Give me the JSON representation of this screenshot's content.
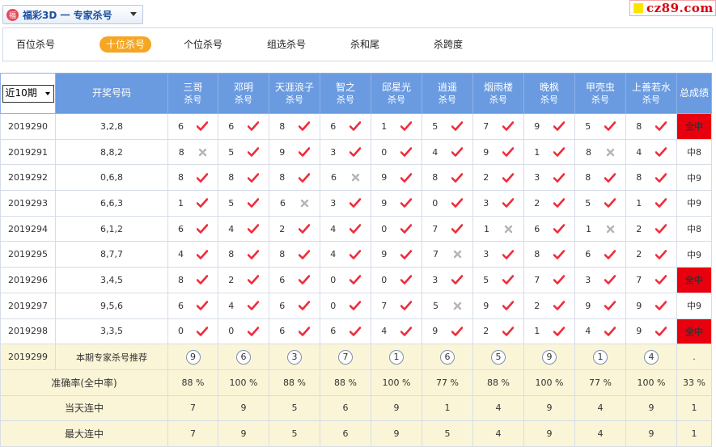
{
  "header": {
    "lottery_title": "福彩3D 一 专家杀号",
    "site": "cz89.com"
  },
  "tabs": [
    {
      "label": "百位杀号",
      "active": false
    },
    {
      "label": "十位杀号",
      "active": true
    },
    {
      "label": "个位杀号",
      "active": false
    },
    {
      "label": "组选杀号",
      "active": false
    },
    {
      "label": "杀和尾",
      "active": false
    },
    {
      "label": "杀跨度",
      "active": false
    }
  ],
  "table": {
    "period_select": "近10期",
    "draw_col_label": "开奖号码",
    "total_col_label": "总成绩",
    "experts": [
      {
        "name": "三哥",
        "sub": "杀号"
      },
      {
        "name": "邓明",
        "sub": "杀号"
      },
      {
        "name": "天涯浪子",
        "sub": "杀号"
      },
      {
        "name": "智之",
        "sub": "杀号"
      },
      {
        "name": "邱星光",
        "sub": "杀号"
      },
      {
        "name": "逍遥",
        "sub": "杀号"
      },
      {
        "name": "烟雨楼",
        "sub": "杀号"
      },
      {
        "name": "晚枫",
        "sub": "杀号"
      },
      {
        "name": "甲壳虫",
        "sub": "杀号"
      },
      {
        "name": "上善若水",
        "sub": "杀号"
      }
    ],
    "rows": [
      {
        "period": "2019290",
        "draw": "3,2,8",
        "picks": [
          "6",
          "6",
          "8",
          "6",
          "1",
          "5",
          "7",
          "9",
          "5",
          "8"
        ],
        "hits": [
          1,
          1,
          1,
          1,
          1,
          1,
          1,
          1,
          1,
          1
        ],
        "result": "全中",
        "full": true
      },
      {
        "period": "2019291",
        "draw": "8,8,2",
        "picks": [
          "8",
          "5",
          "9",
          "3",
          "0",
          "4",
          "9",
          "1",
          "8",
          "4"
        ],
        "hits": [
          0,
          1,
          1,
          1,
          1,
          1,
          1,
          1,
          0,
          1
        ],
        "result": "中8",
        "full": false
      },
      {
        "period": "2019292",
        "draw": "0,6,8",
        "picks": [
          "8",
          "8",
          "8",
          "6",
          "9",
          "8",
          "2",
          "3",
          "8",
          "8"
        ],
        "hits": [
          1,
          1,
          1,
          0,
          1,
          1,
          1,
          1,
          1,
          1
        ],
        "result": "中9",
        "full": false
      },
      {
        "period": "2019293",
        "draw": "6,6,3",
        "picks": [
          "1",
          "5",
          "6",
          "3",
          "9",
          "0",
          "3",
          "2",
          "5",
          "1"
        ],
        "hits": [
          1,
          1,
          0,
          1,
          1,
          1,
          1,
          1,
          1,
          1
        ],
        "result": "中9",
        "full": false
      },
      {
        "period": "2019294",
        "draw": "6,1,2",
        "picks": [
          "6",
          "4",
          "2",
          "4",
          "0",
          "7",
          "1",
          "6",
          "1",
          "2"
        ],
        "hits": [
          1,
          1,
          1,
          1,
          1,
          1,
          0,
          1,
          0,
          1
        ],
        "result": "中8",
        "full": false
      },
      {
        "period": "2019295",
        "draw": "8,7,7",
        "picks": [
          "4",
          "8",
          "8",
          "4",
          "9",
          "7",
          "3",
          "8",
          "6",
          "2"
        ],
        "hits": [
          1,
          1,
          1,
          1,
          1,
          0,
          1,
          1,
          1,
          1
        ],
        "result": "中9",
        "full": false
      },
      {
        "period": "2019296",
        "draw": "3,4,5",
        "picks": [
          "8",
          "2",
          "6",
          "0",
          "0",
          "3",
          "5",
          "7",
          "3",
          "7"
        ],
        "hits": [
          1,
          1,
          1,
          1,
          1,
          1,
          1,
          1,
          1,
          1
        ],
        "result": "全中",
        "full": true
      },
      {
        "period": "2019297",
        "draw": "9,5,6",
        "picks": [
          "6",
          "4",
          "6",
          "0",
          "7",
          "5",
          "9",
          "2",
          "9",
          "9"
        ],
        "hits": [
          1,
          1,
          1,
          1,
          1,
          0,
          1,
          1,
          1,
          1
        ],
        "result": "中9",
        "full": false
      },
      {
        "period": "2019298",
        "draw": "3,3,5",
        "picks": [
          "0",
          "0",
          "6",
          "6",
          "4",
          "9",
          "2",
          "1",
          "4",
          "9"
        ],
        "hits": [
          1,
          1,
          1,
          1,
          1,
          1,
          1,
          1,
          1,
          1
        ],
        "result": "全中",
        "full": true
      }
    ],
    "recommend": {
      "period": "2019299",
      "label": "本期专家杀号推荐",
      "picks": [
        "9",
        "6",
        "3",
        "7",
        "1",
        "6",
        "5",
        "9",
        "1",
        "4"
      ],
      "total": "."
    },
    "stats": [
      {
        "label": "准确率(全中率)",
        "values": [
          "88 %",
          "100 %",
          "88 %",
          "88 %",
          "100 %",
          "77 %",
          "88 %",
          "100 %",
          "77 %",
          "100 %"
        ],
        "total": "33 %"
      },
      {
        "label": "当天连中",
        "values": [
          "7",
          "9",
          "5",
          "6",
          "9",
          "1",
          "4",
          "9",
          "4",
          "9"
        ],
        "total": "1"
      },
      {
        "label": "最大连中",
        "values": [
          "7",
          "9",
          "5",
          "6",
          "9",
          "5",
          "4",
          "9",
          "4",
          "9"
        ],
        "total": "1"
      }
    ]
  }
}
